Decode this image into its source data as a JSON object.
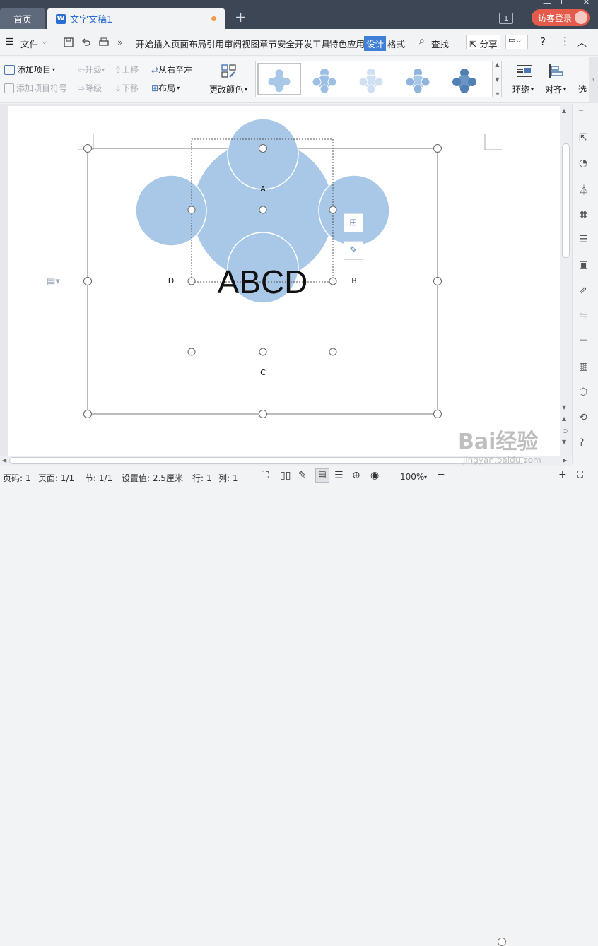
{
  "tabs": {
    "home": "首页",
    "doc": "文字文稿1",
    "page_badge": "1",
    "login": "访客登录"
  },
  "menu": {
    "file": "文件",
    "items": [
      "开始",
      "插入",
      "页面布局",
      "引用",
      "审阅",
      "视图",
      "章节",
      "安全",
      "开发工具",
      "特色应用"
    ],
    "design": "设计",
    "format": "格式",
    "search": "查找",
    "share": "分享"
  },
  "ribbon": {
    "add_item": "添加项目",
    "add_bullet": "添加项目符号",
    "promote": "升级",
    "demote": "降级",
    "move_up": "上移",
    "move_down": "下移",
    "rtl": "从右至左",
    "layout": "布局",
    "change_color": "更改颜色",
    "wrap": "环绕",
    "align": "对齐",
    "select": "选"
  },
  "diagram": {
    "center": "ABCD",
    "top": "A",
    "right": "B",
    "bottom": "C",
    "left": "D"
  },
  "status": {
    "page_no": "页码: 1",
    "pages": "页面: 1/1",
    "section": "节: 1/1",
    "setting": "设置值: 2.5厘米",
    "row": "行: 1",
    "col": "列: 1",
    "zoom": "100%"
  },
  "watermark": {
    "main": "Bai经验",
    "url": "jingyan.baidu.com"
  },
  "colors": {
    "accent": "#3f7fd6",
    "circle": "#a9c8e8",
    "circle_overlap": "#8fb5de",
    "login": "#e55b4b"
  }
}
